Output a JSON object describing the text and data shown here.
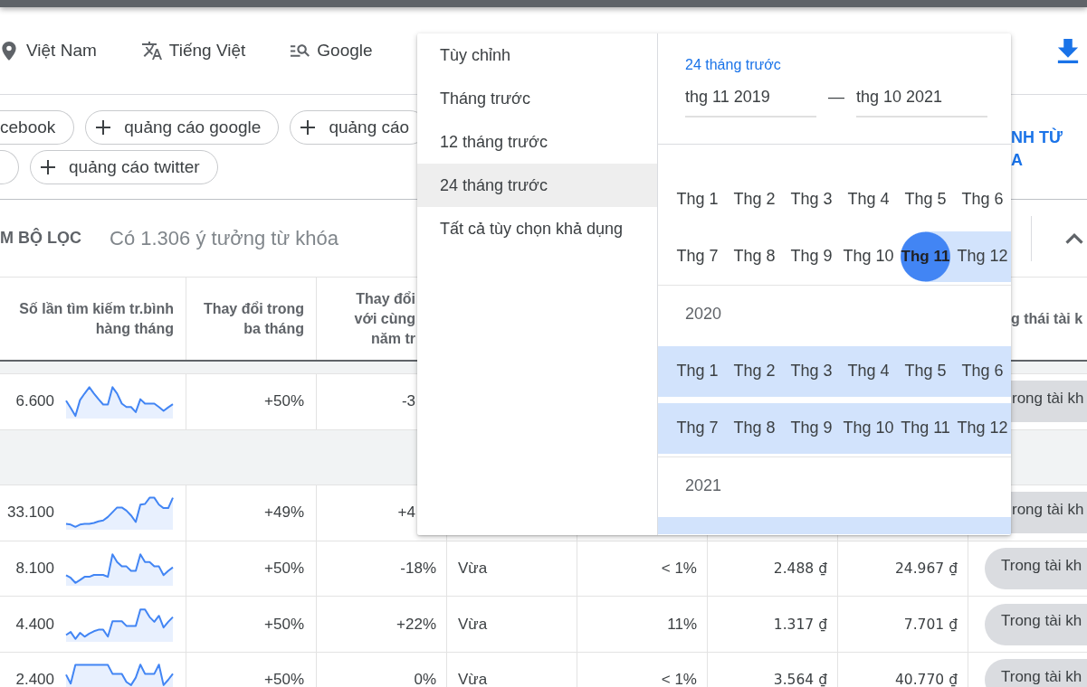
{
  "settings": [
    {
      "kind": "location",
      "label": "Việt Nam"
    },
    {
      "kind": "language",
      "label": "Tiếng Việt"
    },
    {
      "kind": "network",
      "label": "Google"
    }
  ],
  "keyword_chips": [
    [
      {
        "kind": "cut",
        "label": "cebook"
      },
      {
        "kind": "add",
        "label": "quảng cáo google"
      },
      {
        "kind": "add",
        "label": "quảng cáo"
      }
    ],
    [
      {
        "kind": "cut"
      },
      {
        "kind": "add",
        "label": "quảng cáo twitter"
      }
    ]
  ],
  "action_button": {
    "label": "NH TỪ A"
  },
  "filter_bar": {
    "filter_label": "M BỘ LỌC",
    "result_count": "Có 1.306 ý tưởng từ khóa"
  },
  "table": {
    "header": {
      "under_menu": true,
      "search_volume": "Số lần tìm kiếm tr.bình hàng tháng",
      "three_month_change": "Thay đổi trong ba tháng",
      "column_3": "Thay đổi với cùng năm tr",
      "column_8": "g thái tài k"
    },
    "rows": [
      {
        "kind": "covered",
        "search_volume": "6.600",
        "three_month_change": "+50%",
        "column_3": "-3",
        "column_8": "rong tài kh"
      },
      {
        "kind": "group"
      },
      {
        "kind": "covered",
        "search_volume": "33.100",
        "three_month_change": "+49%",
        "column_3": "+4",
        "column_8": "rong tài kh"
      },
      {
        "kind": "keyword",
        "search_volume": "8.100",
        "three_month_change": "+50%",
        "column_3": "-18%",
        "column_4": "Vừa",
        "column_5": "< 1%",
        "column_6": "2.488 ₫",
        "column_7": "24.967 ₫",
        "column_8": "Trong tài kh"
      },
      {
        "kind": "keyword",
        "search_volume": "4.400",
        "three_month_change": "+50%",
        "column_3": "+22%",
        "column_4": "Vừa",
        "column_5": "11%",
        "column_6": "1.317 ₫",
        "column_7": "7.701 ₫",
        "column_8": "Trong tài kh"
      },
      {
        "kind": "keyword",
        "search_volume": "2.400",
        "three_month_change": "+50%",
        "column_3": "0%",
        "column_4": "Vừa",
        "column_5": "< 1%",
        "column_6": "3.564 ₫",
        "column_7": "40.770 ₫",
        "column_8": "Trong tài kh"
      }
    ]
  },
  "date_menu": {
    "options": [
      {
        "label": "Tùy chỉnh",
        "selected": false
      },
      {
        "label": "Tháng trước",
        "selected": false
      },
      {
        "label": "12 tháng trước",
        "selected": false
      },
      {
        "label": "24 tháng trước",
        "selected": true
      },
      {
        "label": "Tất cả tùy chọn khả dụng",
        "selected": false
      }
    ],
    "range_label": "24 tháng trước",
    "start": "thg 11 2019",
    "separator": "—",
    "end": "thg 10 2021",
    "years": [
      {
        "rows": [
          [
            {
              "label": "Thg 1",
              "in_range": false,
              "selected": false
            },
            {
              "label": "Thg 2",
              "in_range": false,
              "selected": false
            },
            {
              "label": "Thg 3",
              "in_range": false,
              "selected": false
            },
            {
              "label": "Thg 4",
              "in_range": false,
              "selected": false
            },
            {
              "label": "Thg 5",
              "in_range": false,
              "selected": false
            },
            {
              "label": "Thg 6",
              "in_range": false,
              "selected": false
            }
          ],
          [
            {
              "label": "Thg 7",
              "in_range": false,
              "selected": false
            },
            {
              "label": "Thg 8",
              "in_range": false,
              "selected": false
            },
            {
              "label": "Thg 9",
              "in_range": false,
              "selected": false
            },
            {
              "label": "Thg 10",
              "in_range": false,
              "selected": false
            },
            {
              "label": "Thg 11",
              "in_range": true,
              "selected": true
            },
            {
              "label": "Thg 12",
              "in_range": true,
              "selected": false
            }
          ]
        ]
      },
      {
        "year": "2020",
        "rows": [
          [
            {
              "label": "Thg 1",
              "in_range": true,
              "selected": false
            },
            {
              "label": "Thg 2",
              "in_range": true,
              "selected": false
            },
            {
              "label": "Thg 3",
              "in_range": true,
              "selected": false
            },
            {
              "label": "Thg 4",
              "in_range": true,
              "selected": false
            },
            {
              "label": "Thg 5",
              "in_range": true,
              "selected": false
            },
            {
              "label": "Thg 6",
              "in_range": true,
              "selected": false
            }
          ],
          [
            {
              "label": "Thg 7",
              "in_range": true,
              "selected": false
            },
            {
              "label": "Thg 8",
              "in_range": true,
              "selected": false
            },
            {
              "label": "Thg 9",
              "in_range": true,
              "selected": false
            },
            {
              "label": "Thg 10",
              "in_range": true,
              "selected": false
            },
            {
              "label": "Thg 11",
              "in_range": true,
              "selected": false
            },
            {
              "label": "Thg 12",
              "in_range": true,
              "selected": false
            }
          ]
        ]
      },
      {
        "year": "2021",
        "next_row_in_range": true
      }
    ]
  }
}
